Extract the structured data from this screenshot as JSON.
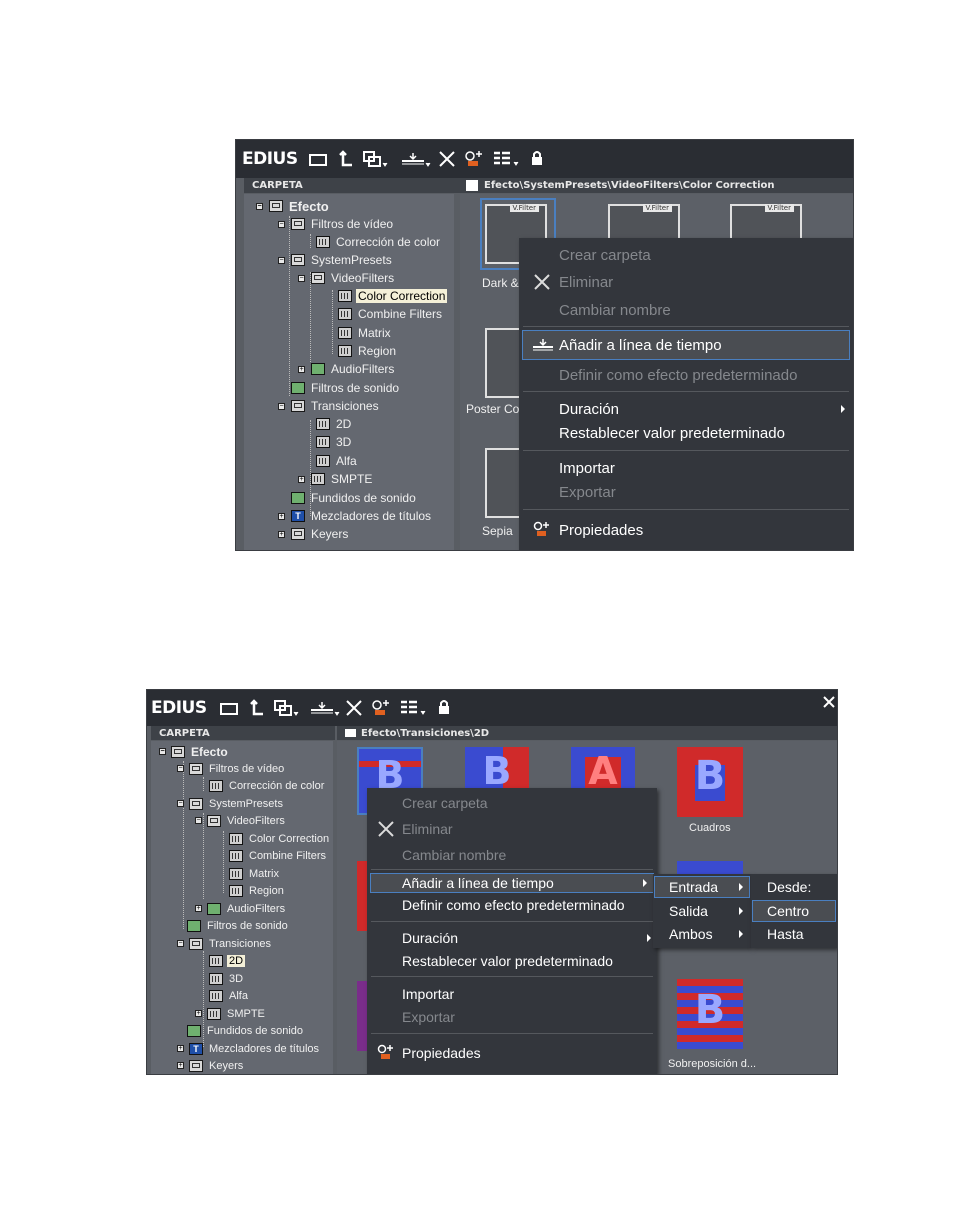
{
  "panel1": {
    "app_logo": "EDIUS",
    "folder_header": "CARPETA",
    "path": "Efecto\\SystemPresets\\VideoFilters\\Color Correction",
    "tree": [
      {
        "label": "Efecto"
      },
      {
        "label": "Filtros de vídeo"
      },
      {
        "label": "Corrección de color"
      },
      {
        "label": "SystemPresets"
      },
      {
        "label": "VideoFilters"
      },
      {
        "label": "Color Correction"
      },
      {
        "label": "Combine Filters"
      },
      {
        "label": "Matrix"
      },
      {
        "label": "Region"
      },
      {
        "label": "AudioFilters"
      },
      {
        "label": "Filtros de sonido"
      },
      {
        "label": "Transiciones"
      },
      {
        "label": "2D"
      },
      {
        "label": "3D"
      },
      {
        "label": "Alfa"
      },
      {
        "label": "SMPTE"
      },
      {
        "label": "Fundidos de sonido"
      },
      {
        "label": "Mezcladores de títulos"
      },
      {
        "label": "Keyers"
      }
    ],
    "thumbs": [
      {
        "caption": "Dark &",
        "badge": "V.Filter"
      },
      {
        "caption": "",
        "badge": "V.Filter"
      },
      {
        "caption": "",
        "badge": "V.Filter"
      },
      {
        "caption": "Poster Co",
        "badge": ""
      },
      {
        "caption": "Sepia",
        "badge": ""
      }
    ],
    "menu": {
      "crear_carpeta": "Crear carpeta",
      "eliminar": "Eliminar",
      "cambiar_nombre": "Cambiar nombre",
      "anadir": "Añadir a línea de tiempo",
      "definir": "Definir como efecto predeterminado",
      "duracion": "Duración",
      "restablecer": "Restablecer valor predeterminado",
      "importar": "Importar",
      "exportar": "Exportar",
      "propiedades": "Propiedades"
    }
  },
  "panel2": {
    "app_logo": "EDIUS",
    "folder_header": "CARPETA",
    "path": "Efecto\\Transiciones\\2D",
    "tree": [
      {
        "label": "Efecto"
      },
      {
        "label": "Filtros de vídeo"
      },
      {
        "label": "Corrección de color"
      },
      {
        "label": "SystemPresets"
      },
      {
        "label": "VideoFilters"
      },
      {
        "label": "Color Correction"
      },
      {
        "label": "Combine Filters"
      },
      {
        "label": "Matrix"
      },
      {
        "label": "Region"
      },
      {
        "label": "AudioFilters"
      },
      {
        "label": "Filtros de sonido"
      },
      {
        "label": "Transiciones"
      },
      {
        "label": "2D"
      },
      {
        "label": "3D"
      },
      {
        "label": "Alfa"
      },
      {
        "label": "SMPTE"
      },
      {
        "label": "Fundidos de sonido"
      },
      {
        "label": "Mezcladores de títulos"
      },
      {
        "label": "Keyers"
      }
    ],
    "thumbs": [
      {
        "caption": "Cuadros"
      },
      {
        "caption": "Sobreposición d..."
      }
    ],
    "menu": {
      "crear_carpeta": "Crear carpeta",
      "eliminar": "Eliminar",
      "cambiar_nombre": "Cambiar nombre",
      "anadir": "Añadir a línea de tiempo",
      "definir": "Definir como efecto predeterminado",
      "duracion": "Duración",
      "restablecer": "Restablecer valor predeterminado",
      "importar": "Importar",
      "exportar": "Exportar",
      "propiedades": "Propiedades"
    },
    "submenu1": {
      "entrada": "Entrada",
      "salida": "Salida",
      "ambos": "Ambos"
    },
    "submenu2": {
      "desde": "Desde:",
      "centro": "Centro",
      "hasta": "Hasta"
    }
  },
  "colors": {
    "toolbar": "#2a2d33",
    "tree_bg": "#646870",
    "menu_bg": "#33363c",
    "highlight_border": "#4a7fc0",
    "selection_bg": "#f4f0d8"
  }
}
